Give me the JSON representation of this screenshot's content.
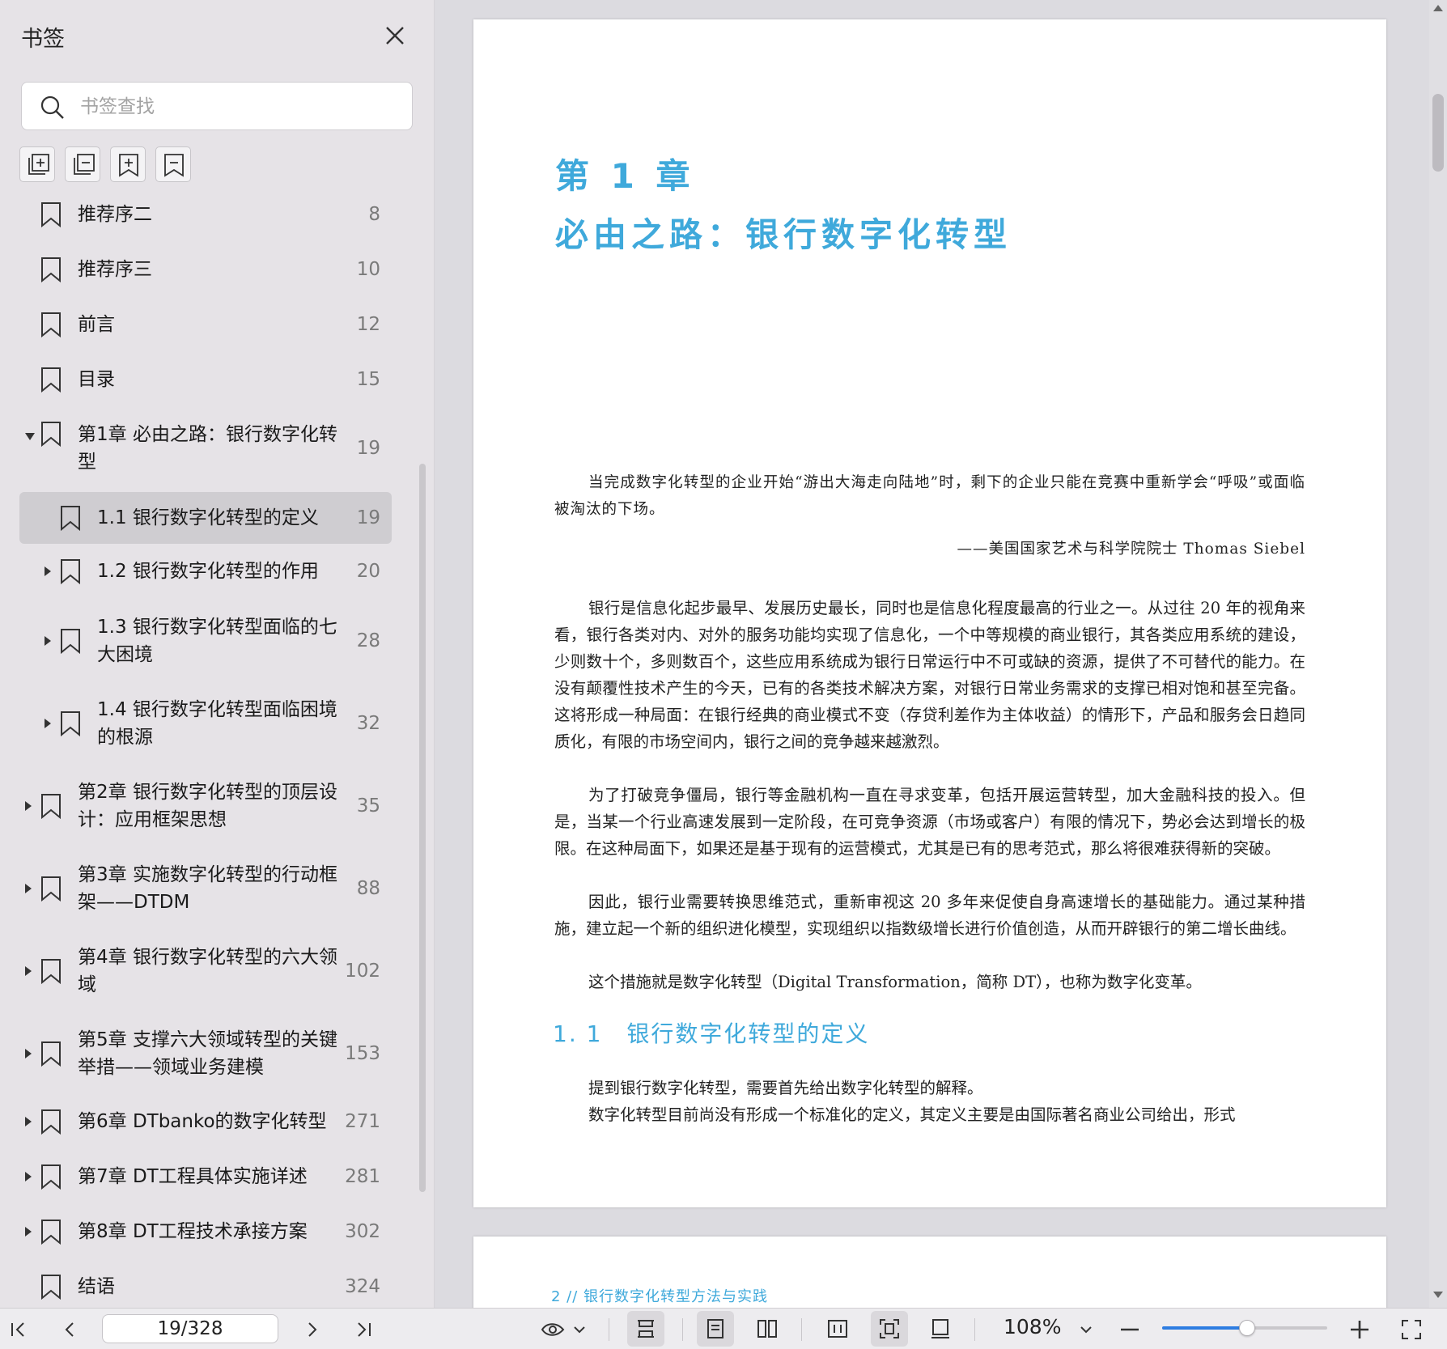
{
  "sidebar": {
    "title": "书签",
    "search_placeholder": "书签查找",
    "items": [
      {
        "label": "推荐序二",
        "page": "8",
        "level": 0,
        "expander": "none"
      },
      {
        "label": "推荐序三",
        "page": "10",
        "level": 0,
        "expander": "none"
      },
      {
        "label": "前言",
        "page": "12",
        "level": 0,
        "expander": "none"
      },
      {
        "label": "目录",
        "page": "15",
        "level": 0,
        "expander": "none"
      },
      {
        "label": "第1章 必由之路：银行数字化转型",
        "page": "19",
        "level": 0,
        "expander": "expanded"
      },
      {
        "label": "1.1 银行数字化转型的定义",
        "page": "19",
        "level": 1,
        "expander": "none",
        "selected": true
      },
      {
        "label": "1.2 银行数字化转型的作用",
        "page": "20",
        "level": 1,
        "expander": "collapsed"
      },
      {
        "label": "1.3 银行数字化转型面临的七大困境",
        "page": "28",
        "level": 1,
        "expander": "collapsed"
      },
      {
        "label": "1.4 银行数字化转型面临困境的根源",
        "page": "32",
        "level": 1,
        "expander": "collapsed"
      },
      {
        "label": "第2章 银行数字化转型的顶层设计：应用框架思想",
        "page": "35",
        "level": 0,
        "expander": "collapsed"
      },
      {
        "label": "第3章 实施数字化转型的行动框架——DTDM",
        "page": "88",
        "level": 0,
        "expander": "collapsed"
      },
      {
        "label": "第4章 银行数字化转型的六大领域",
        "page": "102",
        "level": 0,
        "expander": "collapsed"
      },
      {
        "label": "第5章 支撑六大领域转型的关键举措——领域业务建模",
        "page": "153",
        "level": 0,
        "expander": "collapsed"
      },
      {
        "label": "第6章 DTbanko的数字化转型",
        "page": "271",
        "level": 0,
        "expander": "collapsed"
      },
      {
        "label": "第7章 DT工程具体实施详述",
        "page": "281",
        "level": 0,
        "expander": "collapsed"
      },
      {
        "label": "第8章 DT工程技术承接方案",
        "page": "302",
        "level": 0,
        "expander": "collapsed"
      },
      {
        "label": "结语",
        "page": "324",
        "level": 0,
        "expander": "none"
      }
    ]
  },
  "document": {
    "chapter_number": "第 1 章",
    "chapter_title": "必由之路：银行数字化转型",
    "epigraph": "当完成数字化转型的企业开始“游出大海走向陆地”时，剩下的企业只能在竞赛中重新学会“呼吸”或面临被淘汰的下场。",
    "epigraph_attribution": "——美国国家艺术与科学院院士 Thomas Siebel",
    "paragraphs": [
      "银行是信息化起步最早、发展历史最长，同时也是信息化程度最高的行业之一。从过往 20 年的视角来看，银行各类对内、对外的服务功能均实现了信息化，一个中等规模的商业银行，其各类应用系统的建设，少则数十个，多则数百个，这些应用系统成为银行日常运行中不可或缺的资源，提供了不可替代的能力。在没有颠覆性技术产生的今天，已有的各类技术解决方案，对银行日常业务需求的支撑已相对饱和甚至完备。这将形成一种局面：在银行经典的商业模式不变（存贷利差作为主体收益）的情形下，产品和服务会日趋同质化，有限的市场空间内，银行之间的竞争越来越激烈。",
      "为了打破竞争僵局，银行等金融机构一直在寻求变革，包括开展运营转型，加大金融科技的投入。但是，当某一个行业高速发展到一定阶段，在可竞争资源（市场或客户）有限的情况下，势必会达到增长的极限。在这种局面下，如果还是基于现有的运营模式，尤其是已有的思考范式，那么将很难获得新的突破。",
      "因此，银行业需要转换思维范式，重新审视这 20 多年来促使自身高速增长的基础能力。通过某种措施，建立起一个新的组织进化模型，实现组织以指数级增长进行价值创造，从而开辟银行的第二增长曲线。",
      "这个措施就是数字化转型（Digital Transformation，简称 DT），也称为数字化变革。"
    ],
    "section_title": "1. 1　银行数字化转型的定义",
    "section_paragraphs": [
      "提到银行数字化转型，需要首先给出数字化转型的解释。",
      "数字化转型目前尚没有形成一个标准化的定义，其定义主要是由国际著名商业公司给出，形式"
    ],
    "next_page_header": "2  //   银行数字化转型方法与实践"
  },
  "bottombar": {
    "page_indicator": "19/328",
    "zoom": "108%",
    "zoom_level": 0.51
  },
  "colors": {
    "accent": "#3fa9db",
    "slider": "#2e7de1",
    "selected_row": "#cfcdd1"
  }
}
